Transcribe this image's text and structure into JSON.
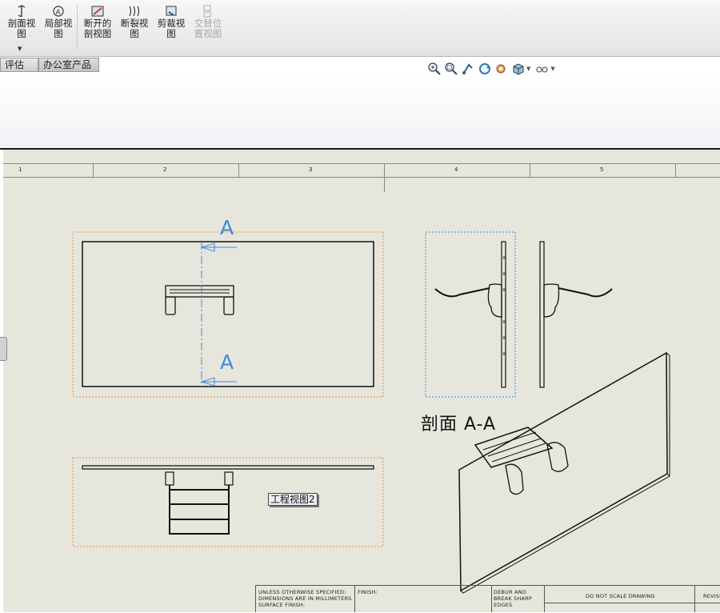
{
  "toolbar": {
    "buttons": [
      {
        "label_line1": "剖面视",
        "label_line2": "图",
        "icon": "section-view-icon"
      },
      {
        "label_line1": "局部视",
        "label_line2": "图",
        "icon": "detail-view-icon"
      },
      {
        "label_line1": "断开的",
        "label_line2": "剖视图",
        "icon": "broken-out-section-icon"
      },
      {
        "label_line1": "断裂视",
        "label_line2": "图",
        "icon": "break-view-icon"
      },
      {
        "label_line1": "剪裁视",
        "label_line2": "图",
        "icon": "crop-view-icon"
      },
      {
        "label_line1": "交替位",
        "label_line2": "置视图",
        "icon": "alternate-position-view-icon",
        "disabled": true
      }
    ],
    "dropdown_caret": "▼"
  },
  "tabs": [
    {
      "label": "评估"
    },
    {
      "label": "办公室产品"
    }
  ],
  "view_tools": [
    "zoom-to-fit-icon",
    "zoom-to-area-icon",
    "previous-view-icon",
    "rebuild-icon",
    "view-setting-icon",
    "display-style-icon",
    "view-orientation-icon"
  ],
  "sheet": {
    "zones": [
      "1",
      "2",
      "3",
      "4",
      "5"
    ],
    "section_markers": {
      "top": "A",
      "bottom": "A"
    },
    "section_title": "剖面  A-A",
    "view_label": "工程视图2",
    "colors": {
      "sheet": "#e6e6dc",
      "selection": "#f08c3c",
      "section_line": "#3c8cdc"
    }
  },
  "title_block": {
    "tolerance_note": [
      "UNLESS OTHERWISE SPECIFIED:",
      "DIMENSIONS ARE IN MILLIMETERS",
      "SURFACE FINISH:"
    ],
    "finish_label": "FINISH:",
    "deburr_note": [
      "DEBUR AND",
      "BREAK SHARP",
      "EDGES"
    ],
    "scale_note": "DO NOT SCALE DRAWING",
    "revision_label": "REVISI"
  }
}
